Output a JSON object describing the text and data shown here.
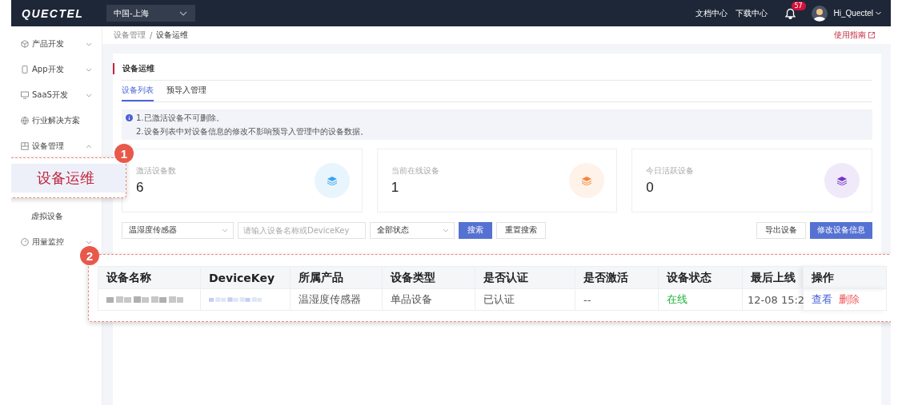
{
  "top_bar": {
    "logo": "QUECTEL",
    "region": "中国-上海",
    "links": [
      "文档中心",
      "下载中心"
    ],
    "notification_count": "57",
    "user": "Hi_Quectel"
  },
  "sidebar": {
    "items": [
      {
        "label": "产品开发",
        "expanded": false
      },
      {
        "label": "App开发",
        "expanded": false
      },
      {
        "label": "SaaS开发",
        "expanded": false
      },
      {
        "label": "行业解决方案"
      },
      {
        "label": "设备管理",
        "expanded": true,
        "children": [
          {
            "label": "虚拟设备"
          }
        ]
      },
      {
        "label": "用量监控",
        "expanded": false
      }
    ]
  },
  "breadcrumb": [
    "设备管理",
    "设备运维"
  ],
  "breadcrumb_separator": "/",
  "guide_link": "使用指南",
  "page": {
    "title": "设备运维",
    "tabs": [
      {
        "label": "设备列表",
        "selected": true
      },
      {
        "label": "预导入管理",
        "selected": false
      }
    ],
    "notices": [
      "1.已激活设备不可删除。",
      "2.设备列表中对设备信息的修改不影响预导入管理中的设备数据。"
    ],
    "stats": [
      {
        "label": "激活设备数",
        "value": "6",
        "color": "#3ba4f0"
      },
      {
        "label": "当前在线设备",
        "value": "1",
        "color": "#f5883a"
      },
      {
        "label": "今日活跃设备",
        "value": "0",
        "color": "#7436c9"
      }
    ],
    "filters": {
      "product": "温湿度传感器",
      "search_placeholder": "请输入设备名称或DeviceKey",
      "status": "全部状态"
    },
    "buttons": [
      {
        "label": "搜索",
        "kind": "primary"
      },
      {
        "label": "重置搜索",
        "kind": "default"
      }
    ],
    "actions": [
      {
        "label": "导出设备",
        "kind": "default"
      },
      {
        "label": "修改设备信息",
        "kind": "primary"
      }
    ]
  },
  "callouts": [
    {
      "number": "1",
      "text": "设备运维"
    },
    {
      "number": "2"
    }
  ],
  "table": {
    "columns": [
      "设备名称",
      "DeviceKey",
      "所属产品",
      "设备类型",
      "是否认证",
      "是否激活",
      "设备状态",
      "最后上线",
      "操作"
    ],
    "rows": [
      {
        "cells": [
          {
            "kind": "blurred"
          },
          {
            "kind": "blurred-link"
          },
          {
            "kind": "text",
            "text": "温湿度传感器"
          },
          {
            "kind": "text",
            "text": "单品设备"
          },
          {
            "kind": "text",
            "text": "已认证"
          },
          {
            "kind": "text",
            "text": "--"
          },
          {
            "kind": "status",
            "text": "在线",
            "online": true
          },
          {
            "kind": "text",
            "text": "12-08 15:2"
          }
        ],
        "actions": [
          {
            "label": "查看",
            "kind": "view"
          },
          {
            "label": "删除",
            "kind": "delete"
          }
        ]
      }
    ]
  }
}
